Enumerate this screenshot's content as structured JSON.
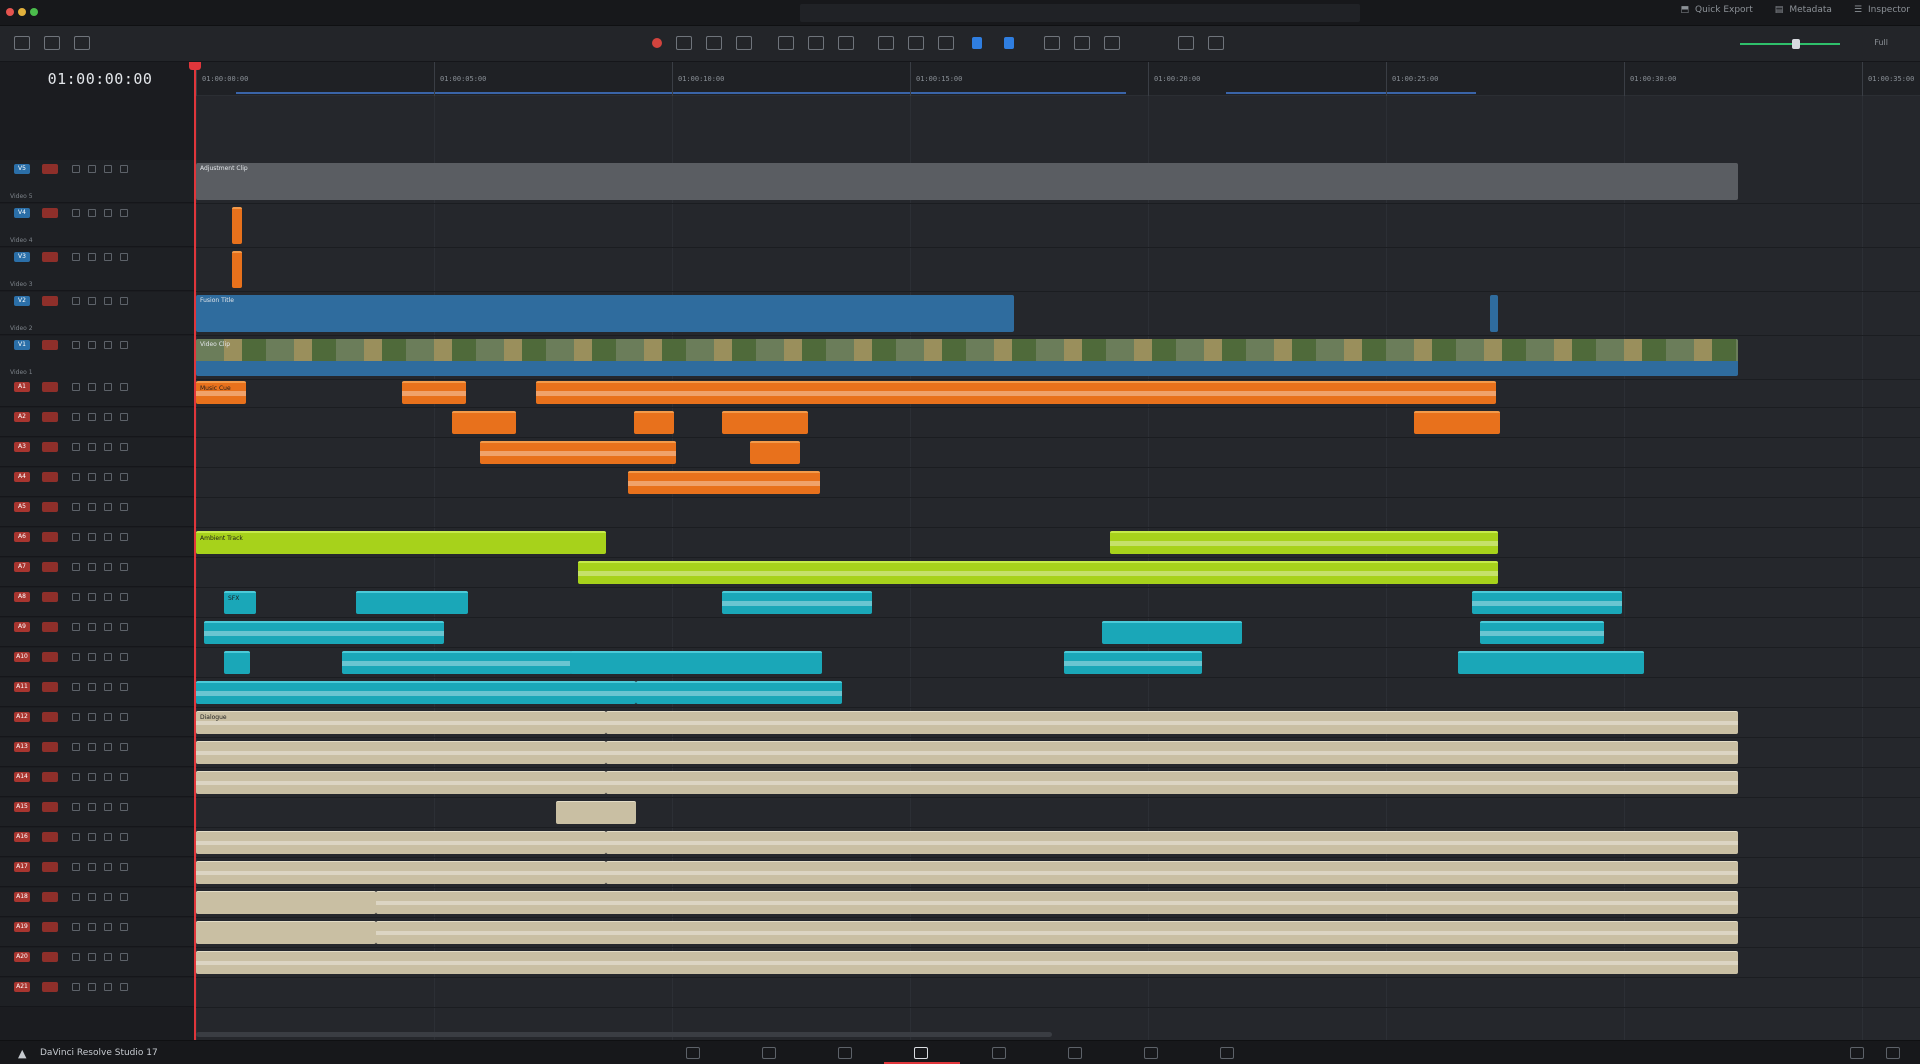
{
  "window": {
    "titlebar_right": [
      "Quick Export",
      "Metadata",
      "Inspector"
    ]
  },
  "toolbar": {
    "zoom_value": "Full"
  },
  "timeline": {
    "timecode": "01:00:00:00",
    "ruler_ticks": [
      "01:00:00:00",
      "01:00:05:00",
      "01:00:10:00",
      "01:00:15:00",
      "01:00:20:00",
      "01:00:25:00",
      "01:00:30:00",
      "01:00:35:00"
    ]
  },
  "tracks": {
    "video": [
      "V5",
      "V4",
      "V3",
      "V2",
      "V1"
    ],
    "video_names": [
      "Video 5",
      "Video 4",
      "Video 3",
      "Video 2",
      "Video 1"
    ],
    "audio": [
      "A1",
      "A2",
      "A3",
      "A4",
      "A5",
      "A6",
      "A7",
      "A8",
      "A9",
      "A10",
      "A11",
      "A12",
      "A13",
      "A14",
      "A15",
      "A16",
      "A17",
      "A18",
      "A19",
      "A20",
      "A21"
    ]
  },
  "clips": {
    "v5_adjust": "Adjustment Clip",
    "v2_title": "Fusion Title",
    "v1_main": "Video Clip",
    "a_orange_1": "Music Cue",
    "a_lime_1": "Ambient Track",
    "a_teal_1": "SFX",
    "a_beige_1": "Dialogue"
  },
  "footer": {
    "app_name": "DaVinci Resolve Studio 17"
  }
}
